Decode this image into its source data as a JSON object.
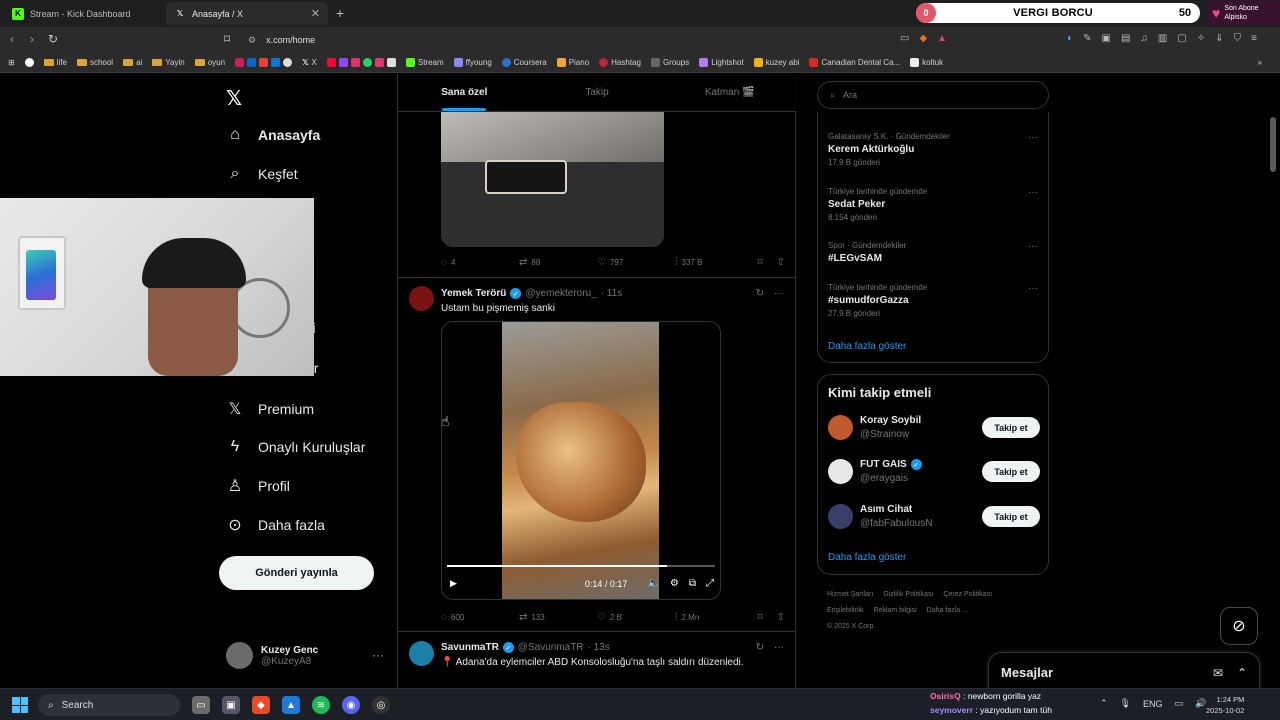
{
  "browser": {
    "tabs": [
      {
        "label": "Stream - Kick Dashboard",
        "icon": "kick-icon",
        "active": false
      },
      {
        "label": "Anasayfa / X",
        "icon": "x-logo-icon",
        "active": true
      }
    ],
    "url": "x.com/home",
    "bookmarks": [
      {
        "label": "",
        "icon": "google-icon"
      },
      {
        "label": "life",
        "icon": "folder-icon"
      },
      {
        "label": "school",
        "icon": "folder-icon"
      },
      {
        "label": "ai",
        "icon": "folder-icon"
      },
      {
        "label": "Yayin",
        "icon": "folder-icon"
      },
      {
        "label": "oyun",
        "icon": "folder-icon"
      },
      {
        "label": "X",
        "icon": "x-logo-icon"
      },
      {
        "label": "Stream",
        "icon": "kick-icon"
      },
      {
        "label": "ffyoung",
        "icon": "link-icon"
      },
      {
        "label": "Coursera",
        "icon": "coursera-icon"
      },
      {
        "label": "Piano",
        "icon": "piano-icon"
      },
      {
        "label": "Hashtag",
        "icon": "hashtag-icon"
      },
      {
        "label": "Groups",
        "icon": "groups-icon"
      },
      {
        "label": "Lightshot",
        "icon": "lightshot-icon"
      },
      {
        "label": "kuzey abi",
        "icon": "drive-icon"
      },
      {
        "label": "Canadian Dental Ca...",
        "icon": "maple-icon"
      },
      {
        "label": "koltuk",
        "icon": "amazon-icon"
      }
    ]
  },
  "overlay": {
    "vergi_title": "VERGI BORCU",
    "vergi_current": "0",
    "vergi_goal": "50",
    "son_abone_label": "Son Abone",
    "son_abone_name": "Alpisko"
  },
  "nav": {
    "items": [
      {
        "label": "Anasayfa",
        "icon": "home-icon",
        "bold": true
      },
      {
        "label": "Keşfet",
        "icon": "search-icon"
      },
      {
        "label": "eri",
        "icon": "bookmark-icon"
      },
      {
        "label": "ar",
        "icon": "groups-icon"
      },
      {
        "label": "Premium",
        "icon": "x-logo-icon"
      },
      {
        "label": "Onaylı Kuruluşlar",
        "icon": "lightning-icon"
      },
      {
        "label": "Profil",
        "icon": "person-icon"
      },
      {
        "label": "Daha fazla",
        "icon": "more-circle-icon"
      }
    ],
    "post_button": "Gönderi yayınla",
    "user_name": "Kuzey Genc",
    "user_handle": "@KuzeyA8"
  },
  "timeline": {
    "tabs": [
      "Sana özel",
      "Takip",
      "Katman 🎬"
    ],
    "post1_actions": {
      "replies": "4",
      "reposts": "88",
      "likes": "797",
      "views": "337 B"
    },
    "post2": {
      "name": "Yemek Terörü",
      "handle": "@yemekteroru_",
      "time": "· 11s",
      "text": "Ustam bu pişmemiş sanki",
      "video_time": "0:14 / 0:17",
      "video_progress": 0.82,
      "actions": {
        "replies": "600",
        "reposts": "133",
        "likes": "2 B",
        "views": "2 Mn"
      }
    },
    "post3": {
      "name": "SavunmaTR",
      "handle": "@SavunmaTR",
      "time": "· 13s",
      "text": "📍 Adana'da eylemciler ABD Konsolosluğu'na taşlı saldırı düzenledi."
    }
  },
  "right": {
    "search_placeholder": "Ara",
    "trends": [
      {
        "category": "Galatasaray S.K. · Gündemdekiler",
        "title": "Kerem Aktürkoğlu",
        "count": "17,9 B gönderi"
      },
      {
        "category": "Türkiye tarihinde gündemde",
        "title": "Sedat Peker",
        "count": "8.154 gönderi"
      },
      {
        "category": "Spor · Gündemdekiler",
        "title": "#LEGvSAM",
        "count": ""
      },
      {
        "category": "Türkiye tarihinde gündemde",
        "title": "#sumudforGazza",
        "count": "27,9 B gönderi"
      }
    ],
    "show_more": "Daha fazla göster",
    "who_title": "Kimi takip etmeli",
    "who": [
      {
        "name": "Koray Soybil",
        "handle": "@Strainow",
        "verified": false,
        "button": "Takip et"
      },
      {
        "name": "FUT GAIS",
        "handle": "@eraygais",
        "verified": true,
        "button": "Takip et"
      },
      {
        "name": "Asım Cihat",
        "handle": "@fabFabulousN",
        "verified": false,
        "button": "Takip et"
      }
    ],
    "who_show_more": "Daha fazla göster",
    "footer": [
      "Hizmet Şartları",
      "Gizlilik Politikası",
      "Çerez Politikası",
      "Erişilebilirlik",
      "Reklam bilgisi",
      "Daha fazla ...",
      "© 2025 X Corp."
    ],
    "messages": "Mesajlar"
  },
  "taskbar": {
    "search": "Search",
    "chat": [
      {
        "user": "OsirisQ",
        "message": ": newborn gorilla yaz"
      },
      {
        "user": "seymoverr",
        "message": ": yazıyodum tam tüh"
      }
    ],
    "lang": "ENG",
    "time": "1:24 PM",
    "date": "2025-10-02"
  },
  "colors": {
    "accent": "#1d9bf0",
    "border": "#2f3336",
    "muted": "#71767b"
  }
}
